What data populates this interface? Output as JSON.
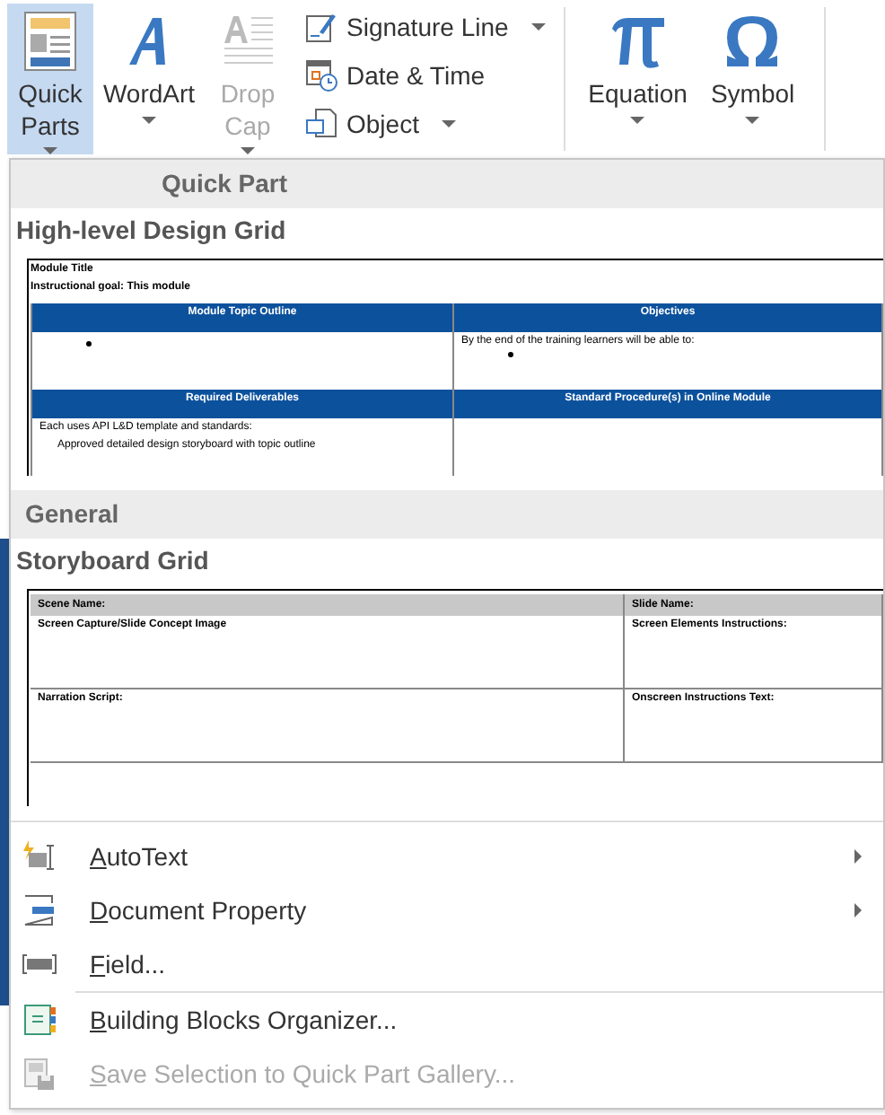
{
  "ribbon": {
    "groups": [
      {
        "buttons": [
          {
            "kind": "large",
            "label": "Quick Parts",
            "selected": true,
            "disabled": false,
            "dropdown": true
          },
          {
            "kind": "large",
            "label": "WordArt",
            "selected": false,
            "disabled": false,
            "dropdown": true
          },
          {
            "kind": "large",
            "label": "Drop Cap",
            "selected": false,
            "disabled": true,
            "dropdown": true
          },
          {
            "kind": "stack",
            "items": [
              {
                "label": "Signature Line",
                "dropdown": true
              },
              {
                "label": "Date & Time",
                "dropdown": false
              },
              {
                "label": "Object",
                "dropdown": true
              }
            ]
          }
        ]
      },
      {
        "buttons": [
          {
            "kind": "large",
            "label": "Equation",
            "selected": false,
            "disabled": false,
            "dropdown": true
          },
          {
            "kind": "large",
            "label": "Symbol",
            "selected": false,
            "disabled": false,
            "dropdown": true
          }
        ]
      }
    ]
  },
  "menu": {
    "sections": [
      {
        "header": "Quick Part",
        "entries": [
          {
            "title": "High-level Design Grid",
            "preview": {
              "kind": "design-grid",
              "title": "Module Title",
              "goal_label": "Instructional goal:",
              "goal_text": "This module",
              "headers_1": [
                "Module Topic Outline",
                "Objectives"
              ],
              "objectives_text": "By the end of the training learners will be able to:",
              "headers_2": [
                "Required Deliverables",
                "Standard Procedure(s) in Online Module"
              ],
              "deliverables_text": "Each uses API L&D template and standards:",
              "deliverables_items": [
                "Approved detailed design storyboard with topic outline"
              ]
            }
          }
        ]
      },
      {
        "header": "General",
        "entries": [
          {
            "title": "Storyboard Grid",
            "preview": {
              "kind": "storyboard",
              "header_cells": [
                "Scene Name:",
                "Slide Name:"
              ],
              "rows": [
                [
                  "Screen Capture/Slide Concept Image",
                  "Screen Elements Instructions:"
                ],
                [
                  "Narration Script:",
                  "Onscreen Instructions  Text:"
                ]
              ]
            }
          }
        ]
      }
    ],
    "items": [
      {
        "label": "AutoText",
        "submenu": true,
        "disabled": false,
        "divider_before": false
      },
      {
        "label": "Document Property",
        "submenu": true,
        "disabled": false,
        "divider_before": false
      },
      {
        "label": "Field...",
        "submenu": false,
        "disabled": false,
        "divider_before": false
      },
      {
        "label": "Building Blocks Organizer...",
        "submenu": false,
        "disabled": false,
        "divider_before": true
      },
      {
        "label": "Save Selection to Quick Part Gallery...",
        "submenu": false,
        "disabled": true,
        "divider_before": false
      }
    ]
  }
}
